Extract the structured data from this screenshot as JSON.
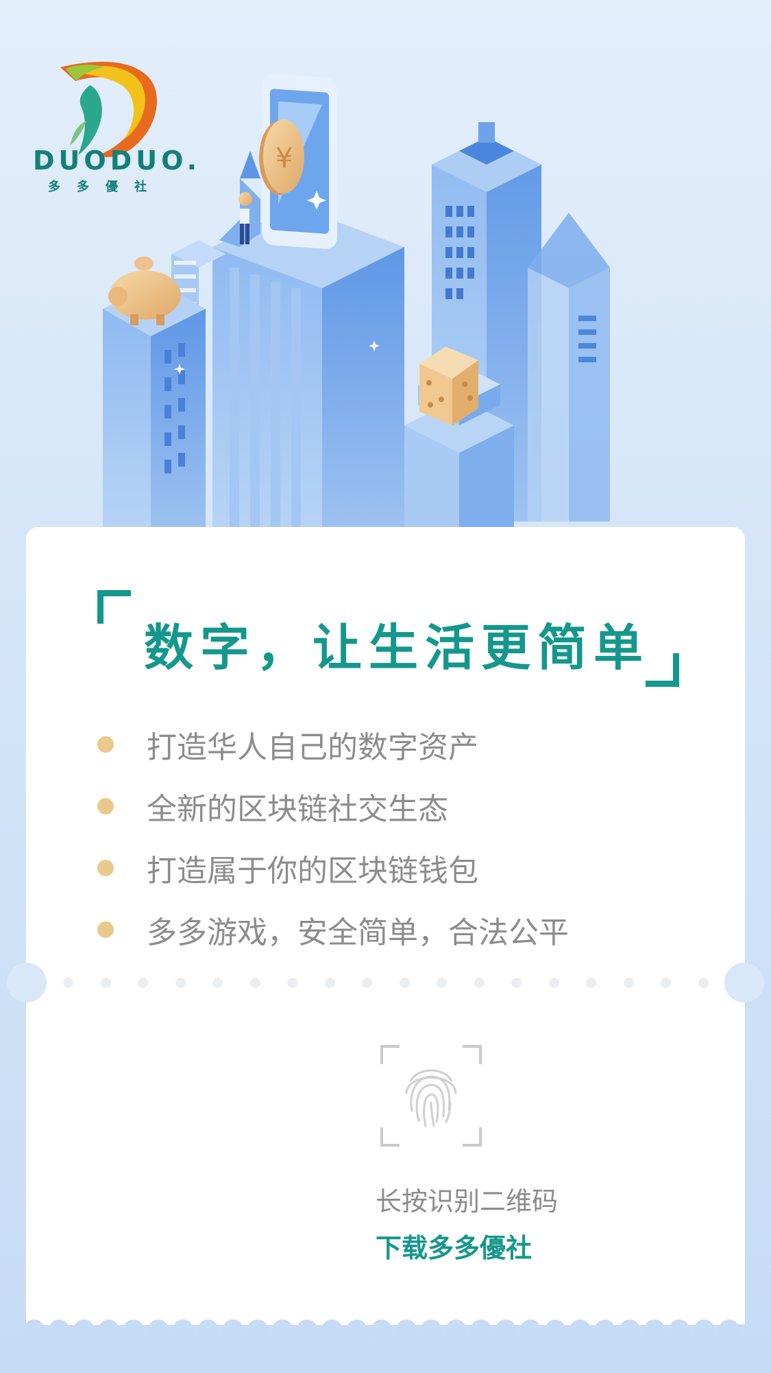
{
  "brand": {
    "logo_icon": "duoduo-logo",
    "name": "DUODUO.",
    "subtitle": "多多優社",
    "colors": {
      "teal": "#14978c",
      "gold": "#eac98d",
      "text_gray": "#8c8c8c"
    }
  },
  "hero": {
    "illustration": "isometric-city-illustration",
    "elements": [
      "smartphone-icon",
      "gold-coin-icon",
      "piggy-bank-icon",
      "dice-icon",
      "person-holding-coin"
    ]
  },
  "card": {
    "headline": "数字，让生活更简单",
    "features": [
      "打造华人自己的数字资产",
      "全新的区块链社交生态",
      "打造属于你的区块链钱包",
      "多多游戏，安全简单，合法公平"
    ]
  },
  "qr": {
    "icon": "fingerprint-icon",
    "hint": "长按识别二维码",
    "cta": "下载多多優社"
  }
}
